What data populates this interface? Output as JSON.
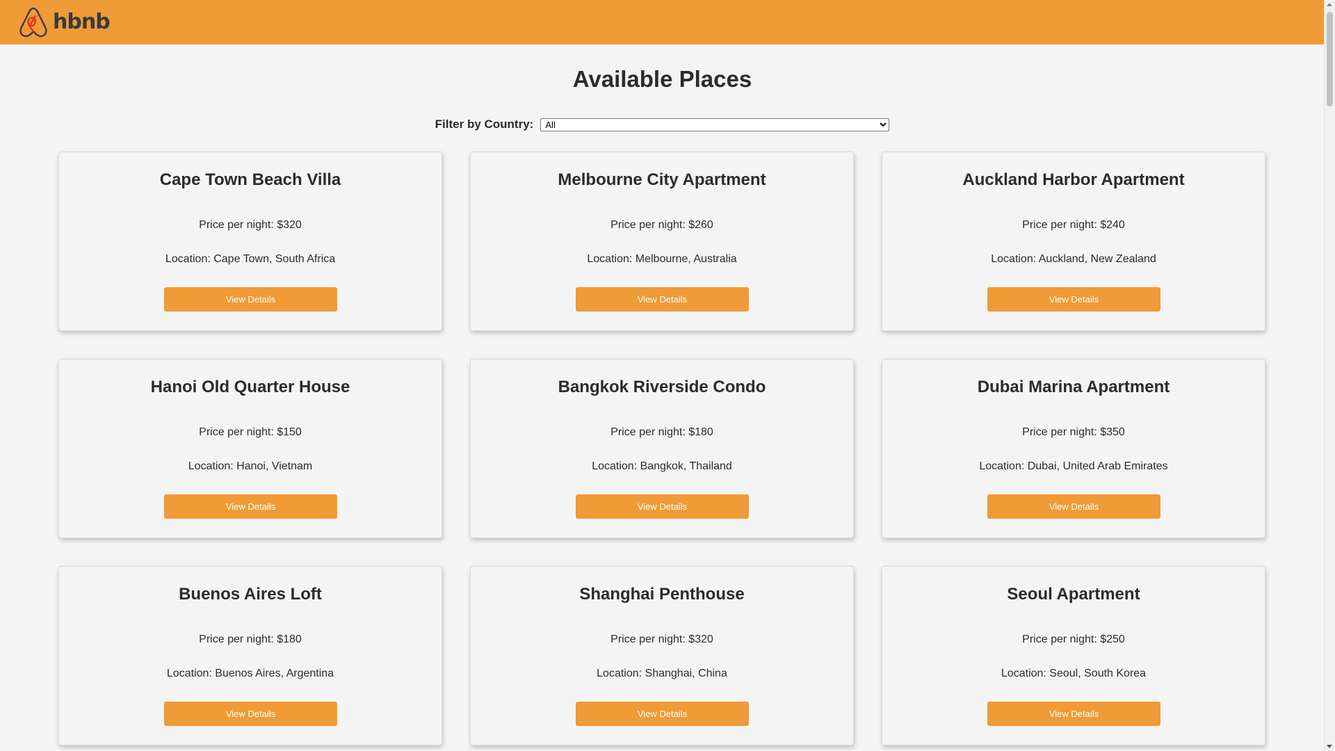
{
  "header": {
    "brand": "hbnb",
    "logo_icon": "airbnb-belo-icon",
    "background_color": "#ef9b37"
  },
  "page": {
    "title": "Available Places"
  },
  "filter": {
    "label": "Filter by Country:",
    "selected": "All"
  },
  "button_color": "#ef9b37",
  "places": [
    {
      "name": "Cape Town Beach Villa",
      "price": "Price per night: $320",
      "location": "Location: Cape Town, South Africa",
      "button": "View Details"
    },
    {
      "name": "Melbourne City Apartment",
      "price": "Price per night: $260",
      "location": "Location: Melbourne, Australia",
      "button": "View Details"
    },
    {
      "name": "Auckland Harbor Apartment",
      "price": "Price per night: $240",
      "location": "Location: Auckland, New Zealand",
      "button": "View Details"
    },
    {
      "name": "Hanoi Old Quarter House",
      "price": "Price per night: $150",
      "location": "Location: Hanoi, Vietnam",
      "button": "View Details"
    },
    {
      "name": "Bangkok Riverside Condo",
      "price": "Price per night: $180",
      "location": "Location: Bangkok, Thailand",
      "button": "View Details"
    },
    {
      "name": "Dubai Marina Apartment",
      "price": "Price per night: $350",
      "location": "Location: Dubai, United Arab Emirates",
      "button": "View Details"
    },
    {
      "name": "Buenos Aires Loft",
      "price": "Price per night: $180",
      "location": "Location: Buenos Aires, Argentina",
      "button": "View Details"
    },
    {
      "name": "Shanghai Penthouse",
      "price": "Price per night: $320",
      "location": "Location: Shanghai, China",
      "button": "View Details"
    },
    {
      "name": "Seoul Apartment",
      "price": "Price per night: $250",
      "location": "Location: Seoul, South Korea",
      "button": "View Details"
    }
  ]
}
